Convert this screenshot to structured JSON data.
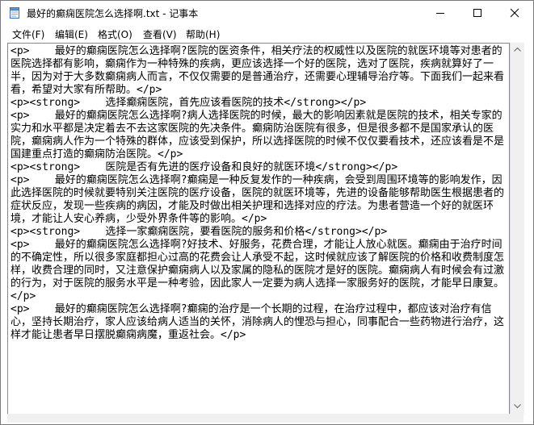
{
  "window": {
    "title": "最好的癫痫医院怎么选择啊.txt - 记事本",
    "icon": "notepad-icon"
  },
  "controls": {
    "minimize": "minimize-icon",
    "maximize": "maximize-icon",
    "close": "close-icon"
  },
  "menu": {
    "file": "文件(F)",
    "edit": "编辑(E)",
    "format": "格式(O)",
    "view": "查看(V)",
    "help": "帮助(H)"
  },
  "editor": {
    "content": "<p>    最好的癫痫医院怎么选择啊?医院的医资条件，相关疗法的权威性以及医院的就医环境等对患者的医院选择都有影响，癫痫作为一种特殊的疾病，更应该选择一个好的医院，选对了医院，疾病就算好了一半，因为对于大多数癫痫病人而言，不仅仅需要的是普通治疗，还需要心理辅导治疗等。下面我们一起来看看，希望对大家有所帮助。</p>\n<p><strong>    选择癫痫医院，首先应该看医院的技术</strong></p>\n<p>    最好的癫痫医院怎么选择啊?病人选择医院的时候，最大的影响因素就是医院的技术，相关专家的实力和水平都是决定着去不去这家医院的先决条件。癫痫防治医院有很多，但是很多都不是国家承认的医院，癫痫病人作为一个特殊的群体，应该受到保护，所以选择医院的时候不仅仅要看技术，还应该看是不是国建重点打造的癫痫防治医院。</p>\n<p><strong>    医院是否有先进的医疗设备和良好的就医环境</strong></p>\n<p>    最好的癫痫医院怎么选择啊?癫痫是一种反复发作的一种疾病，会受到周围环境等的影响发作，因此选择医院的时候就要特别关注医院的医疗设备，医院的就医环境等，先进的设备能够帮助医生根据患者的症状反应，发现一些疾病的病因，才能及时做出相关护理和选择对应的疗法。为患者营造一个好的就医环境，才能让人安心养病，少受外界条件等的影响。</p>\n<p><strong>    选择一家癫痫医院，要看医院的服务和价格</strong></p>\n<p>    最好的癫痫医院怎么选择啊?好技术、好服务，花费合理，才能让人放心就医。癫痫由于治疗时间的不确定性，所以很多家庭都担心过高的花费会让人承受不起，这时候就应该了解医院的价格和收费制度怎样，收费合理的同时，又注意保护癫痫病人以及家属的隐私的医院才是好的医院。癫痫病人有时候会有过激的行为，对于医院的服务水平是一种考验，因此家人一定要为病人选择一家服务好的医院，才能早日康复。</p>\n<p>    最好的癫痫医院怎么选择啊?癫痫的治疗是一个长期的过程，在治疗过程中，都应该对治疗有信心，坚持长期治疗，家人应该给病人适当的关怀，消除病人的悝恐与担心，同事配合一些药物进行治疗，这样才能让患者早日摆脱癫痫病魔，重返社会。</p>"
  }
}
